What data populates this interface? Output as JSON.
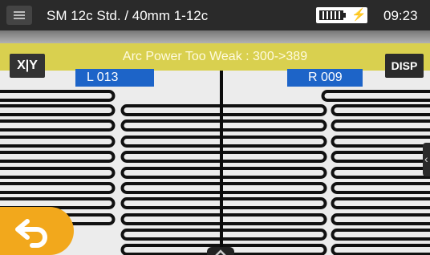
{
  "status_bar": {
    "menu_icon": "menu-icon",
    "program_title": "SM 12c Std. / 40mm 1-12c",
    "battery_icon": "battery-icon",
    "charging_icon": "charging-bolt-icon",
    "time": "09:23"
  },
  "message": "Arc Power Too Weak : 300->389",
  "buttons": {
    "xy_label": "X|Y",
    "disp_label": "DISP",
    "back_icon": "back-arrow-icon",
    "side_tab_icon": "chevron-left-icon"
  },
  "camera_labels": {
    "left": "L  013",
    "right": "R  009"
  },
  "colors": {
    "status_bar": "#2a2a2a",
    "message_bar": "#d9d04f",
    "camera_label": "#1d64c8",
    "back_button": "#f2a81c",
    "fiber_background": "#ececec"
  }
}
